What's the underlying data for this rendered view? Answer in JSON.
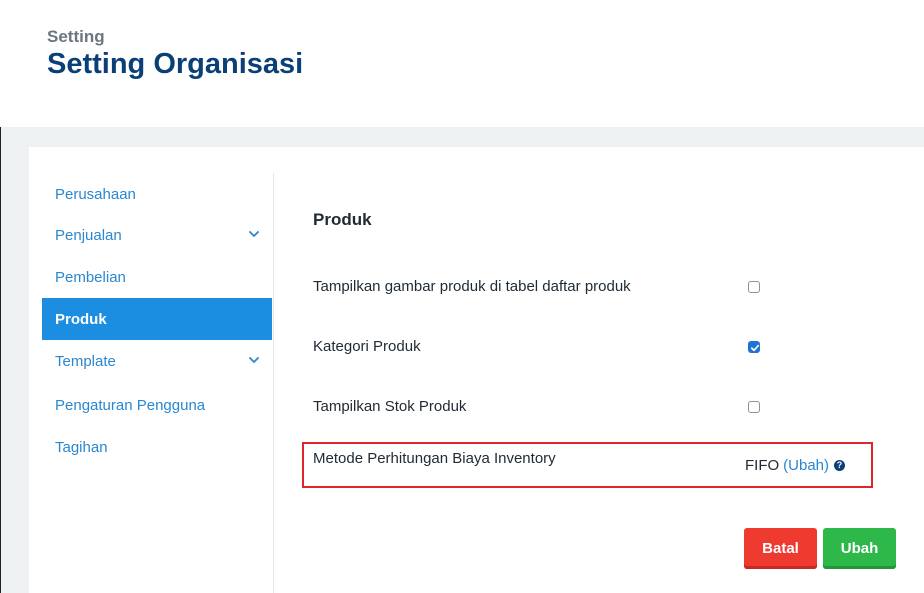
{
  "header": {
    "breadcrumb": "Setting",
    "title": "Setting Organisasi"
  },
  "sidebar": {
    "items": [
      {
        "label": "Perusahaan",
        "expandable": false,
        "active": false
      },
      {
        "label": "Penjualan",
        "expandable": true,
        "active": false
      },
      {
        "label": "Pembelian",
        "expandable": false,
        "active": false
      },
      {
        "label": "Produk",
        "expandable": false,
        "active": true
      },
      {
        "label": "Template",
        "expandable": true,
        "active": false
      },
      {
        "label": "Pengaturan Pengguna",
        "expandable": false,
        "active": false
      },
      {
        "label": "Tagihan",
        "expandable": false,
        "active": false
      }
    ]
  },
  "main": {
    "section_title": "Produk",
    "settings": [
      {
        "label": "Tampilkan gambar produk di tabel daftar produk",
        "checked": false
      },
      {
        "label": "Kategori Produk",
        "checked": true
      },
      {
        "label": "Tampilkan Stok Produk",
        "checked": false
      }
    ],
    "inventory_method": {
      "label": "Metode Perhitungan Biaya Inventory",
      "value": "FIFO",
      "change_link": "(Ubah)",
      "help_icon": "question-circle-icon"
    },
    "buttons": {
      "cancel": "Batal",
      "save": "Ubah"
    }
  },
  "colors": {
    "title": "#0b3f78",
    "link": "#2a87d0",
    "active_nav": "#1b8ee1",
    "cancel": "#ee3a2f",
    "save": "#2fb84a",
    "highlight_border": "#e0262d"
  }
}
